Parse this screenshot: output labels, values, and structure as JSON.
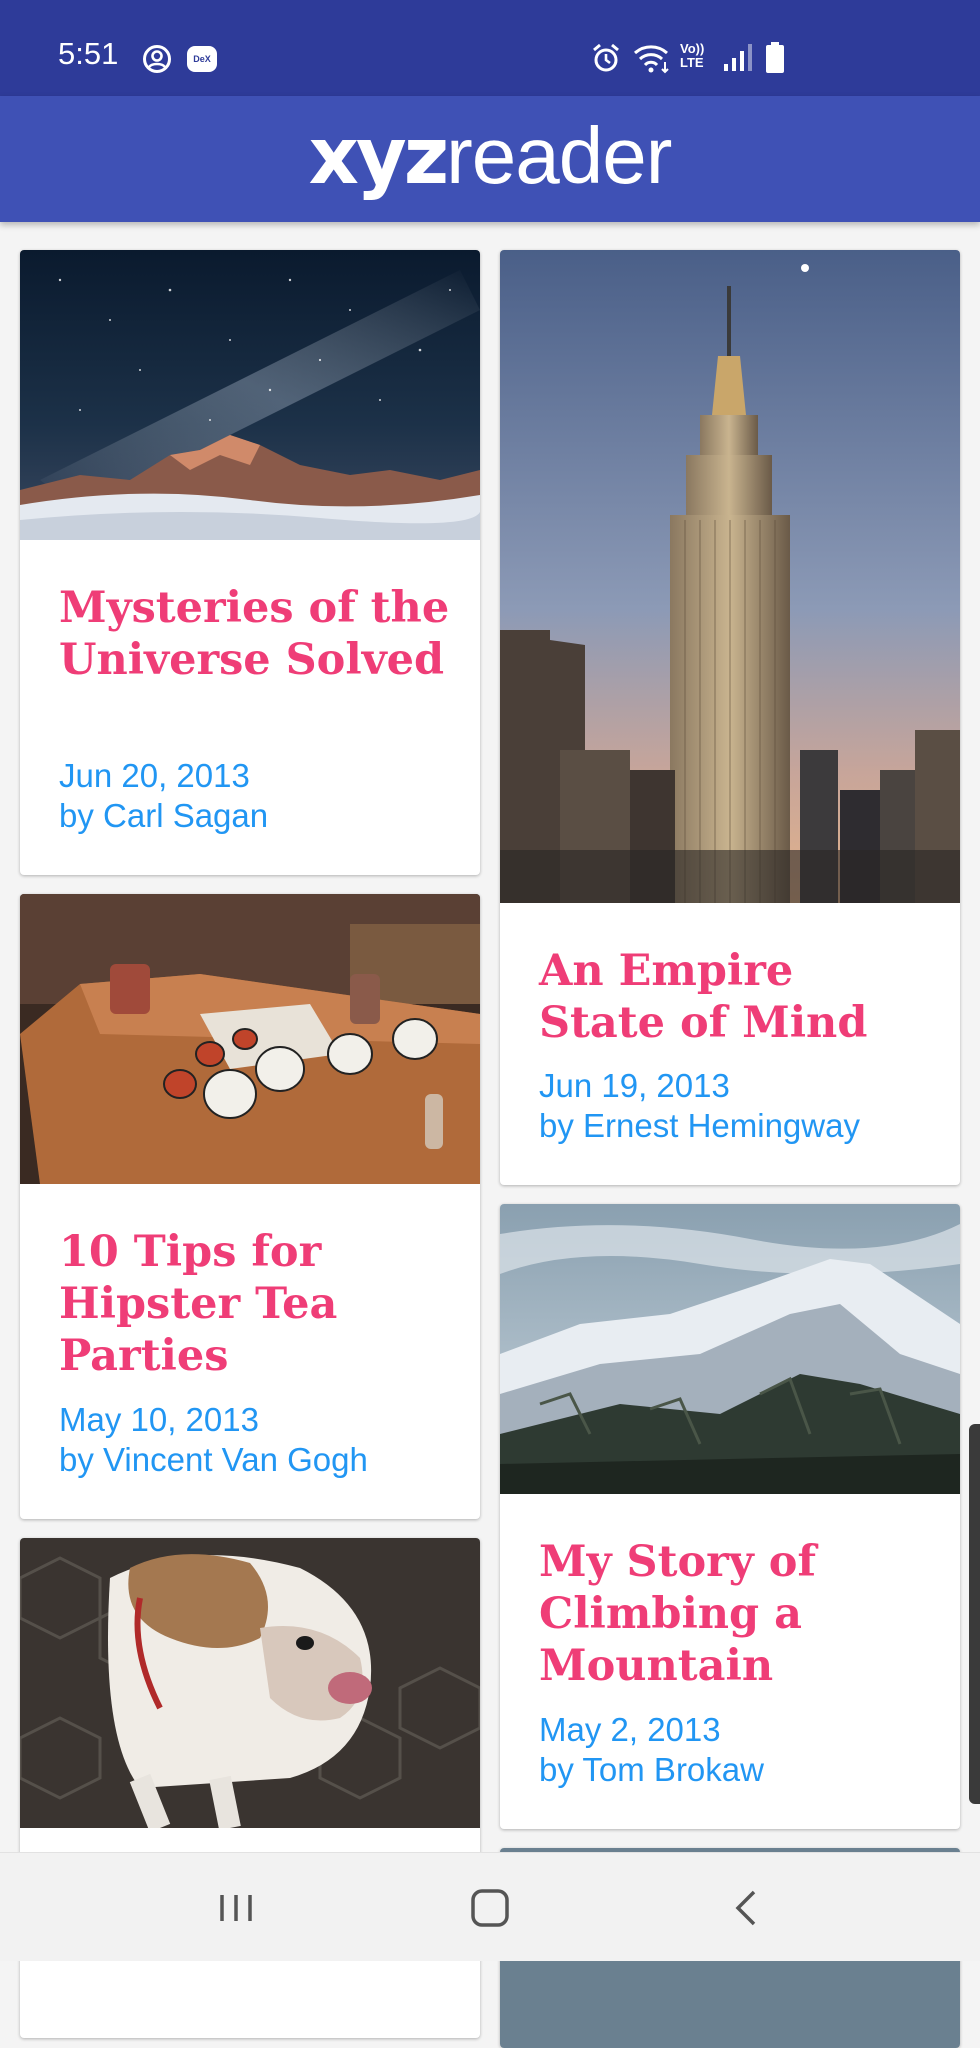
{
  "status_bar": {
    "time": "5:51",
    "left_icons": [
      "account-circle-icon",
      "dex-icon"
    ],
    "dex_label": "DeX",
    "right_icons": [
      "alarm-icon",
      "wifi-icon",
      "volte-icon",
      "signal-icon",
      "battery-icon"
    ],
    "volte_label_top": "Vo))",
    "volte_label_bottom": "LTE"
  },
  "app_bar": {
    "logo_bold": "xyz",
    "logo_light": "reader",
    "background": "#3f51b5"
  },
  "articles": [
    {
      "title": "Mysteries of the Universe Solved",
      "date": "Jun 20, 2013",
      "author": "by Carl Sagan",
      "image": "night-sky-mountain"
    },
    {
      "title": "An Empire State of Mind",
      "date": "Jun 19, 2013",
      "author": "by Ernest Hemingway",
      "image": "empire-state-building"
    },
    {
      "title": "10 Tips for Hipster Tea Parties",
      "date": "May 10, 2013",
      "author": "by Vincent Van Gogh",
      "image": "tea-cups-table"
    },
    {
      "title": "My Story of Climbing a Mountain",
      "date": "May 2, 2013",
      "author": "by Tom Brokaw",
      "image": "snowy-mountain"
    },
    {
      "title": "",
      "date": "",
      "author": "",
      "image": "bulldog"
    }
  ],
  "colors": {
    "status_bar": "#2e3b99",
    "title": "#ef3d77",
    "meta": "#2196f3"
  },
  "nav_bar": {
    "buttons": [
      "recent-apps-icon",
      "home-icon",
      "back-icon"
    ]
  }
}
